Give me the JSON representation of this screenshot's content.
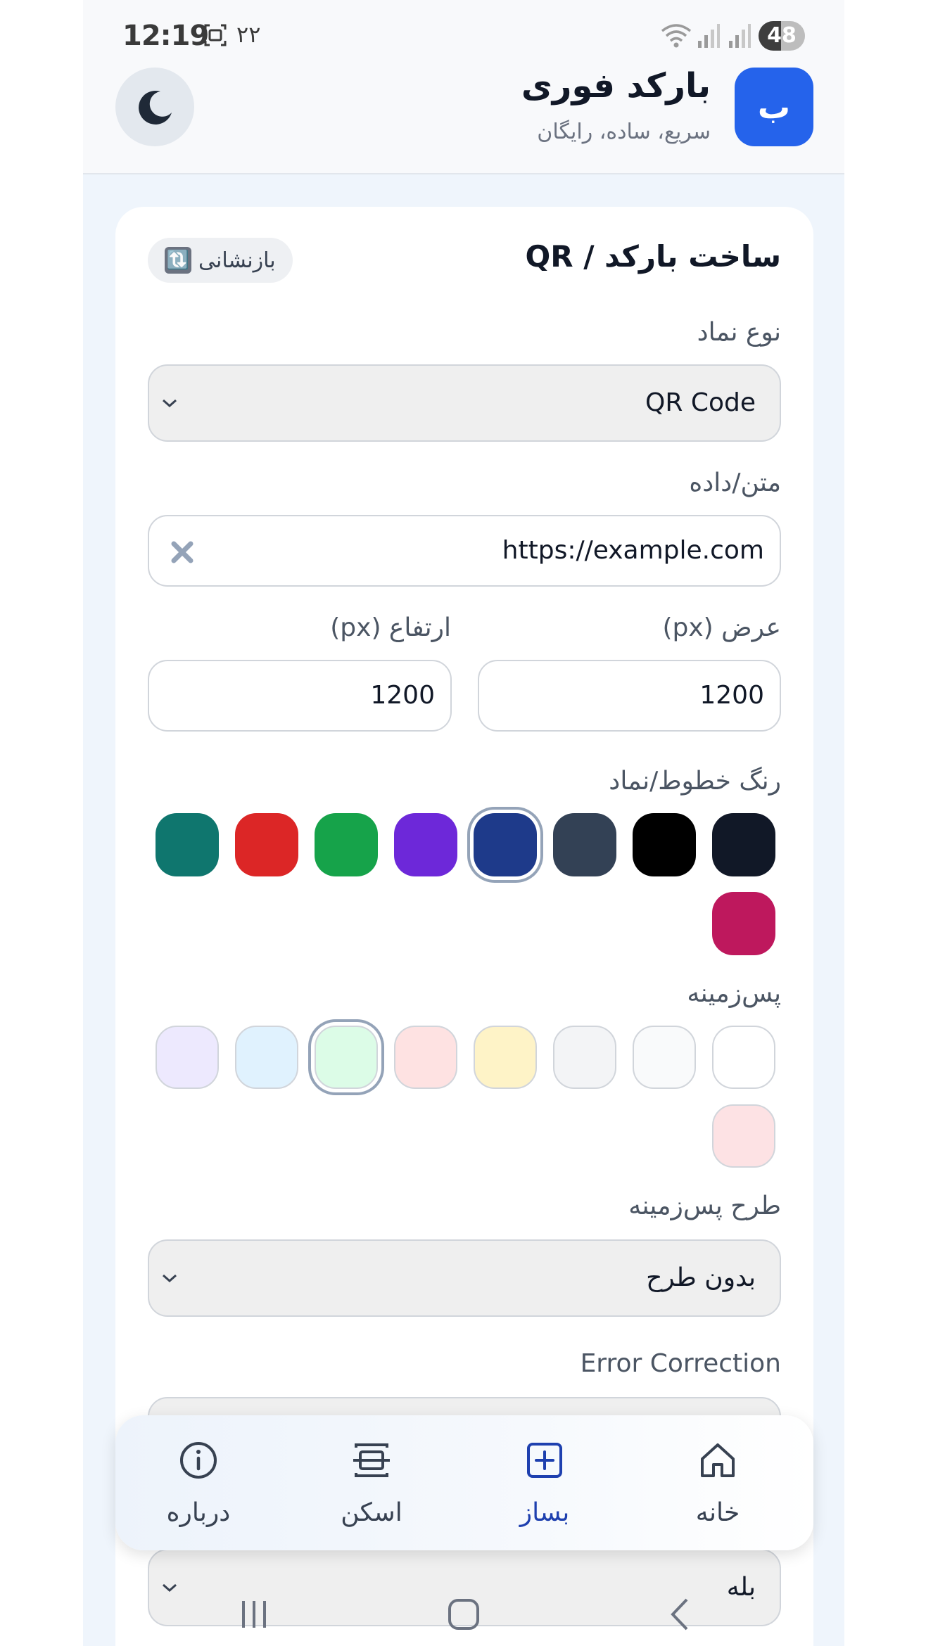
{
  "status_bar": {
    "time": "12:19",
    "extra": "۲۲",
    "battery_level": "48",
    "battery_fraction": 0.48
  },
  "header": {
    "logo_letter": "ب",
    "title": "بارکد فوری",
    "subtitle": "سریع، ساده، رایگان",
    "theme_icon": "moon-icon"
  },
  "card": {
    "title": "ساخت بارکد / QR",
    "reset_label": "بازنشانی",
    "reset_icon": "🔃",
    "symbol_type": {
      "label": "نوع نماد",
      "value": "QR Code"
    },
    "data_field": {
      "label": "متن/داده",
      "value": "https://example.com"
    },
    "width_field": {
      "label": "عرض (px)",
      "value": "1200"
    },
    "height_field": {
      "label": "ارتفاع (px)",
      "value": "1200"
    },
    "line_color": {
      "label": "رنگ خطوط/نماد",
      "colors": [
        "#111827",
        "#000000",
        "#334155",
        "#1e3a8a",
        "#6d28d9",
        "#16a34a",
        "#dc2626",
        "#0f766e",
        "#be185d"
      ],
      "selected": "#1e3a8a"
    },
    "background": {
      "label": "پس‌زمینه",
      "colors": [
        "#ffffff",
        "#f9fafb",
        "#f3f4f6",
        "#fef3c7",
        "#fee2e2",
        "#dcfce7",
        "#e0f2fe",
        "#ede9fe",
        "#fde2e4"
      ],
      "selected": "#dcfce7"
    },
    "bg_pattern": {
      "label": "طرح پس‌زمینه",
      "value": "بدون طرح"
    },
    "error_correction": {
      "label": "Error Correction"
    },
    "hidden_select_value": "بله"
  },
  "bottom_nav": {
    "items": [
      {
        "label": "خانه",
        "icon": "home-icon"
      },
      {
        "label": "بساز",
        "icon": "plus-square-icon",
        "active": true
      },
      {
        "label": "اسکن",
        "icon": "scan-icon"
      },
      {
        "label": "درباره",
        "icon": "info-icon"
      }
    ]
  },
  "colors": {
    "accent": "#2563eb",
    "active_nav": "#1e40af"
  }
}
